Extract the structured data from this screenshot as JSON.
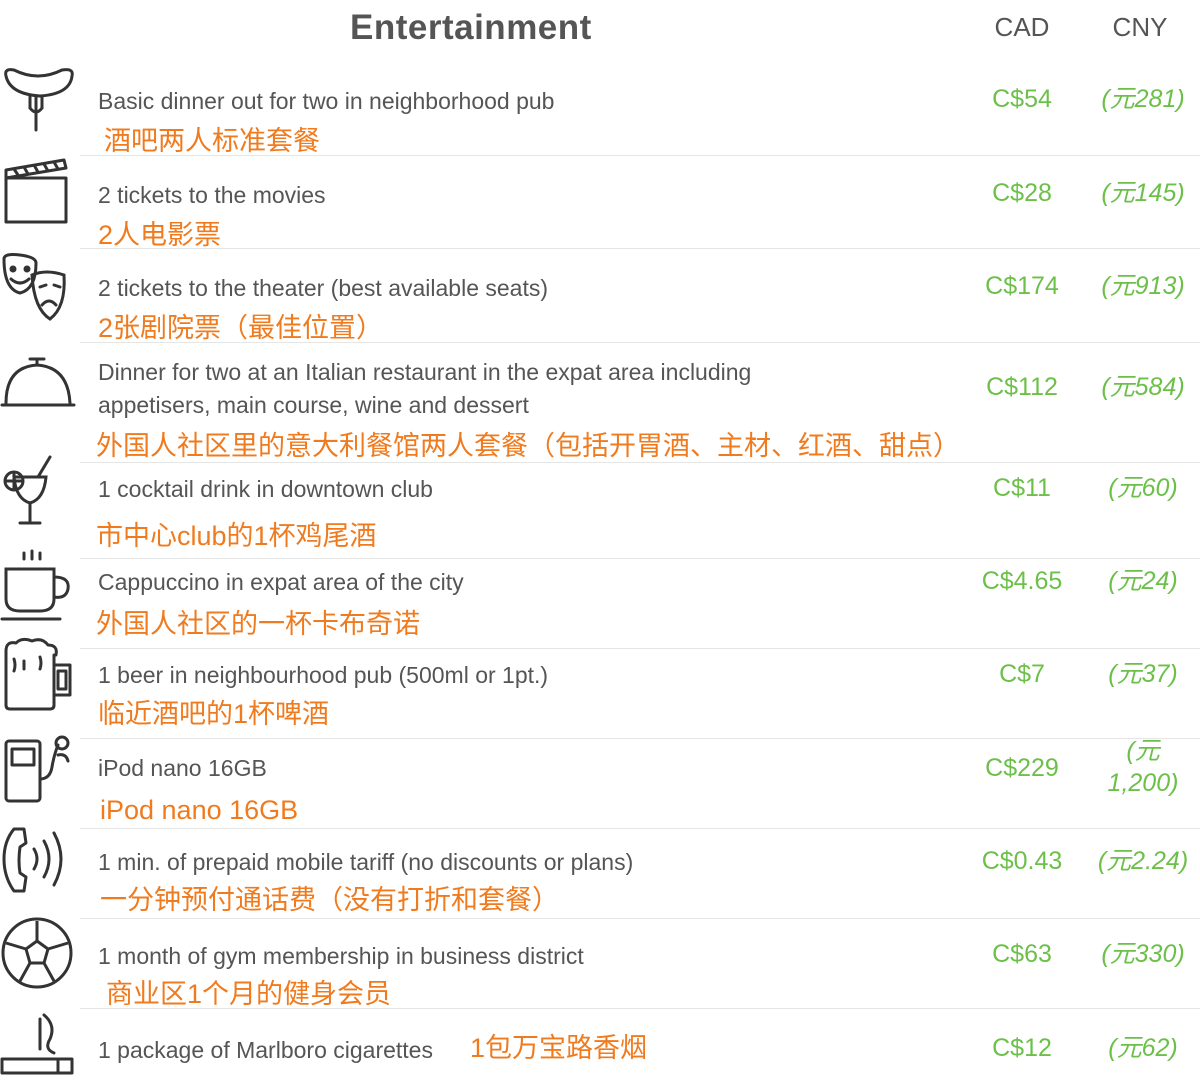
{
  "header": {
    "title": "Entertainment",
    "col_cad": "CAD",
    "col_cny": "CNY"
  },
  "rows": [
    {
      "icon": "sausage-fork-icon",
      "en": "Basic dinner out for two in neighborhood pub",
      "zh": "酒吧两人标准套餐",
      "cad": "C$54",
      "cny": "(元281)"
    },
    {
      "icon": "clapperboard-icon",
      "en": "2 tickets to the movies",
      "zh": "2人电影票",
      "cad": "C$28",
      "cny": "(元145)"
    },
    {
      "icon": "theater-masks-icon",
      "en": "2 tickets to the theater (best available seats)",
      "zh": "2张剧院票（最佳位置）",
      "cad": "C$174",
      "cny": "(元913)"
    },
    {
      "icon": "serving-cloche-icon",
      "en_line1": "Dinner for two at an Italian restaurant in the expat area including",
      "en_line2": "appetisers, main course, wine and dessert",
      "zh": "外国人社区里的意大利餐馆两人套餐（包括开胃酒、主材、红酒、甜点）",
      "cad": "C$112",
      "cny": "(元584)"
    },
    {
      "icon": "cocktail-glass-icon",
      "en": "1 cocktail drink in downtown club",
      "zh": "市中心club的1杯鸡尾酒",
      "cad": "C$11",
      "cny": "(元60)"
    },
    {
      "icon": "coffee-cup-icon",
      "en": "Cappuccino in expat area of the city",
      "zh": "外国人社区的一杯卡布奇诺",
      "cad": "C$4.65",
      "cny": "(元24)"
    },
    {
      "icon": "beer-mug-icon",
      "en": "1 beer in neighbourhood pub (500ml or 1pt.)",
      "zh": "临近酒吧的1杯啤酒",
      "cad": "C$7",
      "cny": "(元37)"
    },
    {
      "icon": "ipod-icon",
      "en": "iPod nano 16GB",
      "zh": "iPod nano 16GB",
      "cad": "C$229",
      "cny_line1": "(元",
      "cny_line2": "1,200)"
    },
    {
      "icon": "phone-ringing-icon",
      "en": "1 min. of prepaid mobile tariff (no discounts or plans)",
      "zh": "一分钟预付通话费（没有打折和套餐）",
      "cad": "C$0.43",
      "cny": "(元2.24)"
    },
    {
      "icon": "soccer-ball-icon",
      "en": "1 month of gym membership in business district",
      "zh": "商业区1个月的健身会员",
      "cad": "C$63",
      "cny": "(元330)"
    },
    {
      "icon": "cigarette-icon",
      "en": "1 package of Marlboro cigarettes",
      "zh": "1包万宝路香烟",
      "cad": "C$12",
      "cny": "(元62)"
    }
  ]
}
